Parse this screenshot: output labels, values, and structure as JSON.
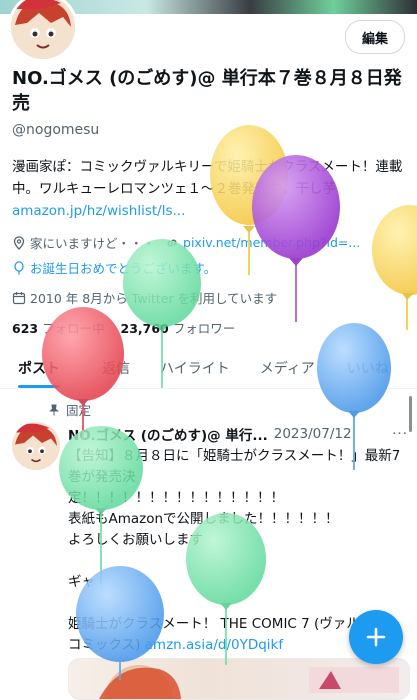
{
  "profile": {
    "edit_label": "編集",
    "display_name": "NO.ゴメス (のごめす)@ 単行本７巻８月８日発売",
    "handle": "@nogomesu",
    "bio_text": "漫画家ぽ：コミックヴァルキリーで姫騎士がクラスメート！連載中。ワルキューレロマンツェ１〜２巻発売中。干し芋 ",
    "bio_link": "amazon.jp/hz/wishlist/ls...",
    "location": "家にいますけど・・・",
    "website": "pixiv.net/member.php?id=...",
    "birthday": "お誕生日おめでとうございます。",
    "joined": "2010 年 8月から Twitter を利用しています",
    "following_count": "623",
    "following_label": "フォロー中",
    "followers_count": "23,760",
    "followers_label": "フォロワー"
  },
  "tabs": [
    {
      "label": "ポスト",
      "active": true
    },
    {
      "label": "返信"
    },
    {
      "label": "ハイライト"
    },
    {
      "label": "メディア"
    },
    {
      "label": "いいね"
    }
  ],
  "pinned_tweet": {
    "pinned_label": "固定",
    "author": "NO.ゴメス (のごめす)@ 単行...",
    "date": "2023/07/12",
    "more": "···",
    "line1": "【告知】８月８日に「姫騎士がクラスメート！」最新7巻が発売決",
    "line2": "定！！！！！！！！！！！！！！！",
    "line3": "表紙もAmazonで公開しました！！！！！！",
    "line4": "よろしくお願いします",
    "line5": "ギャ",
    "line6": "姫騎士がクラスメート！ THE COMIC 7 (ヴァルキリーコミックス) ",
    "link": "amzn.asia/d/0YDqikf"
  },
  "compose_label": "+",
  "colors": {
    "accent": "#1d9bf0",
    "balloon_yellow": "#f5c842",
    "balloon_purple": "#a243d6",
    "balloon_green": "#6fe0a6",
    "balloon_red": "#ec4f5e",
    "balloon_blue": "#5aa7ef"
  }
}
